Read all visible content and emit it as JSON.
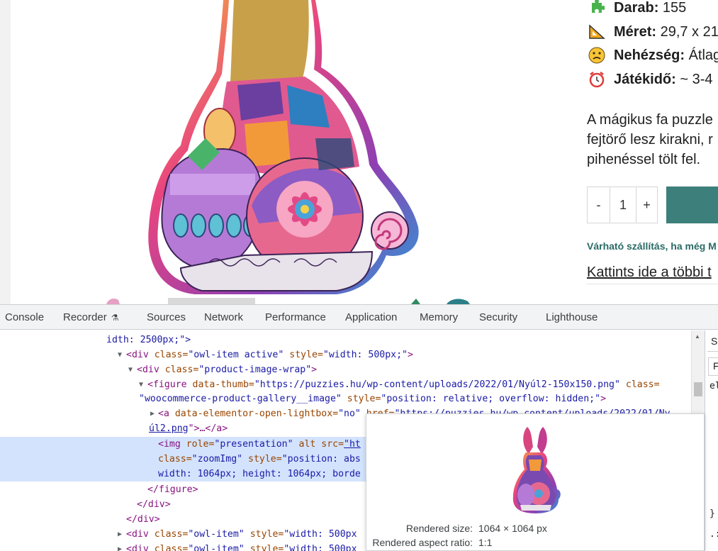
{
  "product": {
    "specs": [
      {
        "icon": "puzzle-piece-icon",
        "label": "Darab:",
        "value": "155"
      },
      {
        "icon": "ruler-triangle-icon",
        "label": "Méret:",
        "value": "29,7 x 21"
      },
      {
        "icon": "confused-face-icon",
        "label": "Nehézség:",
        "value": "Átlag"
      },
      {
        "icon": "alarm-clock-icon",
        "label": "Játékidő:",
        "value": "~ 3-4"
      }
    ],
    "description_lines": [
      "A mágikus fa puzzle",
      "fejtörő lesz kirakni, r",
      "pihenéssel tölt fel."
    ],
    "quantity": {
      "minus": "-",
      "value": "1",
      "plus": "+"
    },
    "shipping_text": "Várható szállítás, ha még M",
    "more_link": "Kattints ide a többi t",
    "colors": {
      "accent": "#3d7f7b",
      "shipping": "#2a6b66"
    }
  },
  "devtools": {
    "tabs": [
      "Console",
      "Recorder",
      "Sources",
      "Network",
      "Performance",
      "Application",
      "Memory",
      "Security",
      "Lighthouse"
    ],
    "elements": {
      "l0": {
        "text": "idth: 2500px;\">"
      },
      "l1": {
        "open": "<div",
        "a1": " class=",
        "v1": "\"owl-item active\"",
        "a2": " style=",
        "v2": "\"width: 500px;\"",
        "close": ">"
      },
      "l2": {
        "open": "<div",
        "a1": " class=",
        "v1": "\"product-image-wrap\"",
        "close": ">"
      },
      "l3": {
        "open": "<figure",
        "a1": " data-thumb=",
        "v1": "\"https://puzzies.hu/wp-content/uploads/2022/01/Nyúl2-150x150.png\"",
        "a2": " class="
      },
      "l4": {
        "v1": "\"woocommerce-product-gallery__image\"",
        "a2": " style=",
        "v2": "\"position: relative; overflow: hidden;\"",
        "close": ">"
      },
      "l5": {
        "open": "<a",
        "a1": " data-elementor-open-lightbox=",
        "v1": "\"no\"",
        "a2": " href=",
        "v2": "\"https://puzzies.hu/wp-content/uploads/2022/01/Ny"
      },
      "l6": {
        "link": "úl2.png",
        "rest": "\">…",
        "close": "</a>"
      },
      "l7": {
        "open": "<img",
        "a1": " role=",
        "v1": "\"presentation\"",
        "a2": " alt",
        "a3": " src=",
        "v3": "\"ht"
      },
      "l8": {
        "a1": "class=",
        "v1": "\"zoomImg\"",
        "a2": " style=",
        "v2": "\"position: abs"
      },
      "l9": {
        "text": "width: 1064px; height: 1064px; borde"
      },
      "l10": {
        "close": "</figure>"
      },
      "l11": {
        "close": "</div>"
      },
      "l12": {
        "close": "</div>"
      },
      "l13": {
        "open": "<div",
        "a1": " class=",
        "v1": "\"owl-item\"",
        "a2": " style=",
        "v2": "\"width: 500px"
      },
      "l14": {
        "open": "<div",
        "a1": " class=",
        "v1": "\"owl-item\"",
        "a2": " style=",
        "v2": "\"width: 500px"
      }
    },
    "side_pane": {
      "tab": "S",
      "filter": "F",
      "element": "el",
      "brace": "}",
      "dots": ".:"
    },
    "tooltip": {
      "rendered_size_label": "Rendered size:",
      "rendered_size_value": "1064 × 1064 px",
      "aspect_ratio_label": "Rendered aspect ratio:",
      "aspect_ratio_value": "1:1"
    }
  }
}
